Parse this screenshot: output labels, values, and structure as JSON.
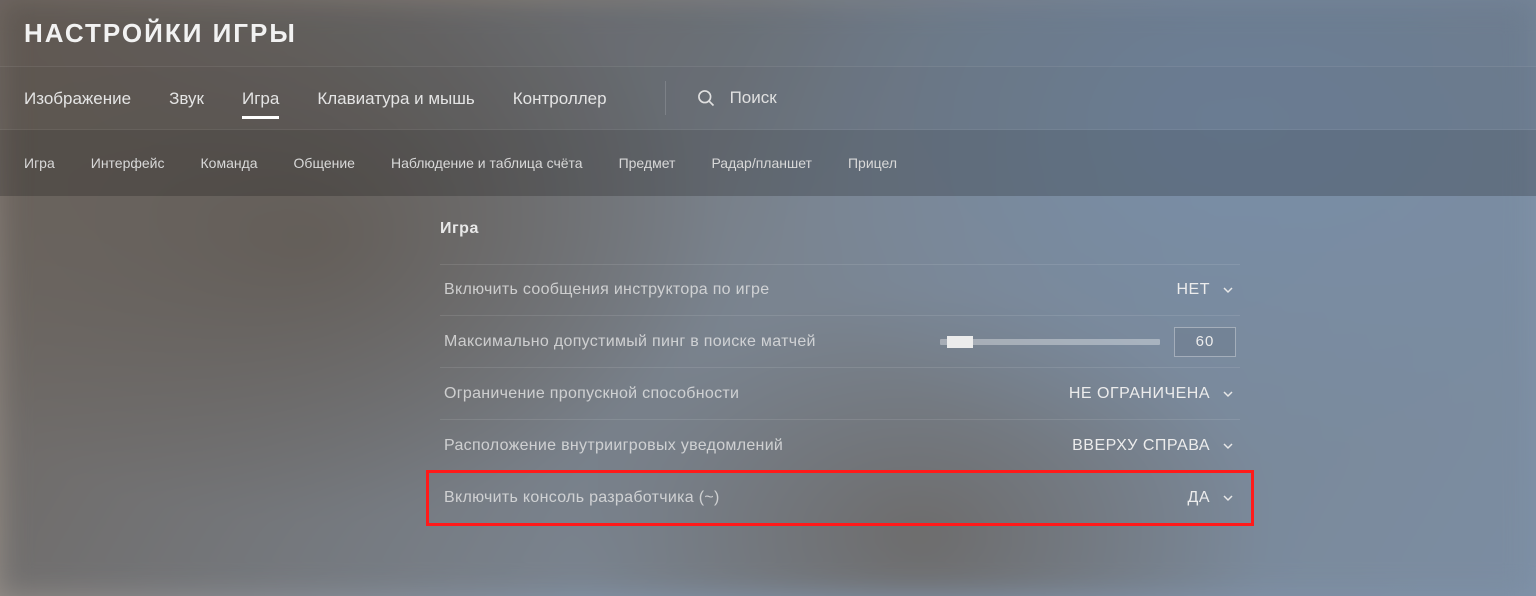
{
  "title": "НАСТРОЙКИ ИГРЫ",
  "tabs_primary": [
    {
      "label": "Изображение",
      "active": false
    },
    {
      "label": "Звук",
      "active": false
    },
    {
      "label": "Игра",
      "active": true
    },
    {
      "label": "Клавиатура и мышь",
      "active": false
    },
    {
      "label": "Контроллер",
      "active": false
    }
  ],
  "search": {
    "label": "Поиск"
  },
  "tabs_secondary": [
    "Игра",
    "Интерфейс",
    "Команда",
    "Общение",
    "Наблюдение и таблица счёта",
    "Предмет",
    "Радар/планшет",
    "Прицел"
  ],
  "section": {
    "title": "Игра",
    "rows": [
      {
        "label": "Включить сообщения инструктора по игре",
        "value": "НЕТ",
        "type": "dropdown"
      },
      {
        "label": "Максимально допустимый пинг в поиске матчей",
        "value": "60",
        "type": "slider",
        "slider_pos_pct": 3
      },
      {
        "label": "Ограничение пропускной способности",
        "value": "НЕ ОГРАНИЧЕНА",
        "type": "dropdown"
      },
      {
        "label": "Расположение внутриигровых уведомлений",
        "value": "ВВЕРХУ СПРАВА",
        "type": "dropdown"
      },
      {
        "label": "Включить консоль разработчика (~)",
        "value": "ДА",
        "type": "dropdown",
        "highlighted": true
      }
    ]
  }
}
